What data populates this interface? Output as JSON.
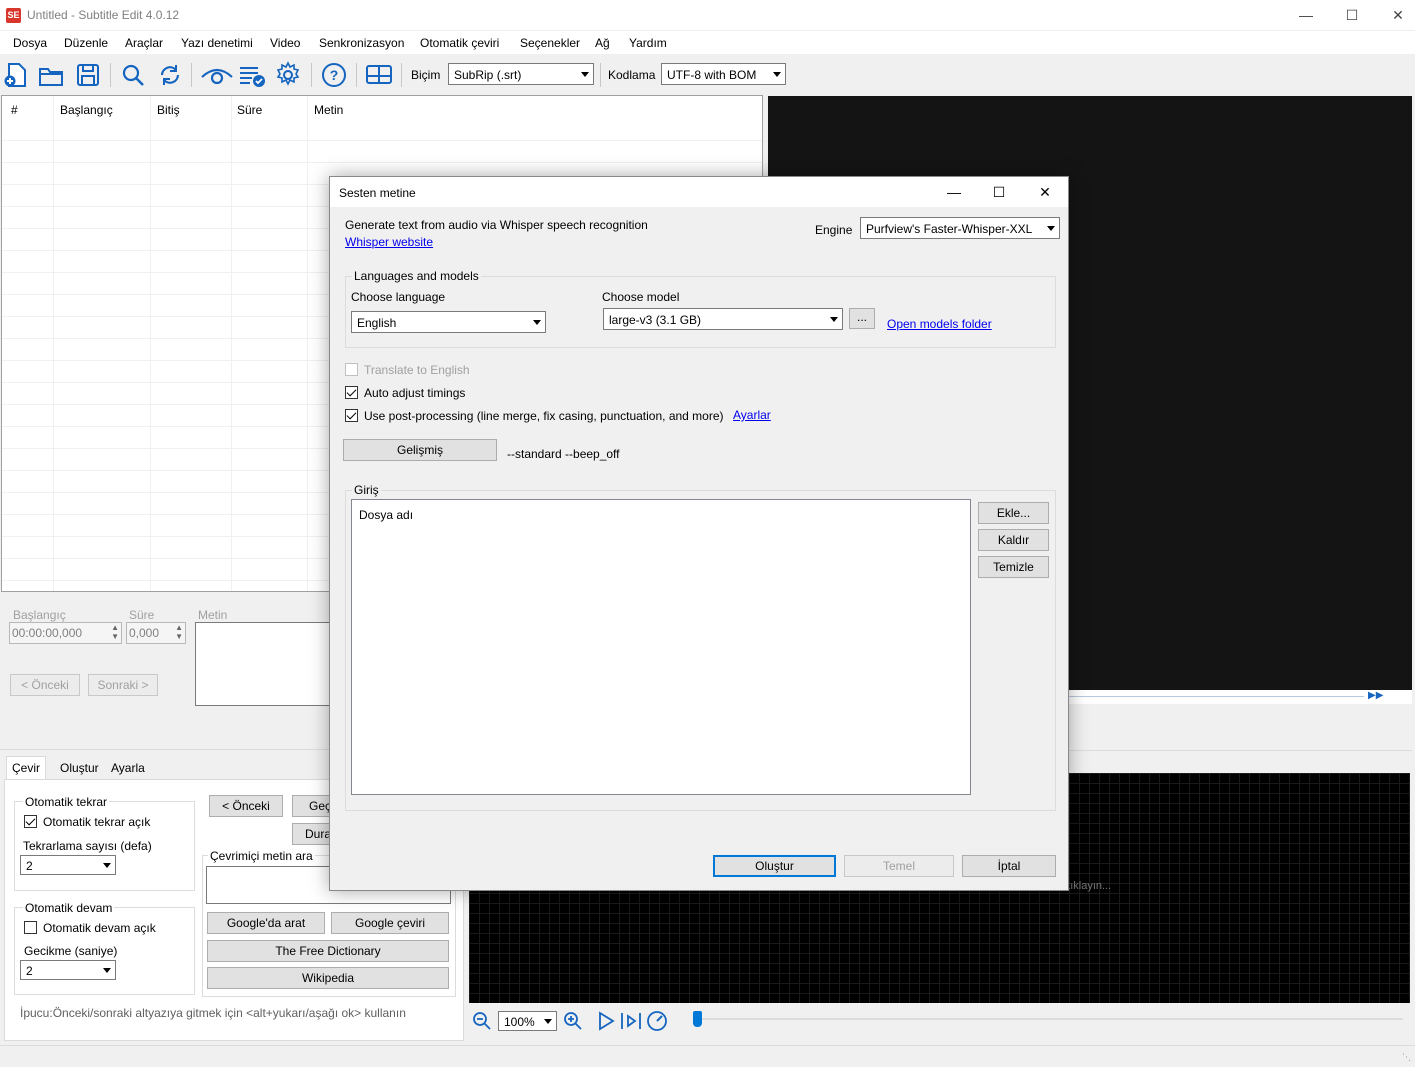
{
  "window": {
    "title": "Untitled - Subtitle Edit 4.0.12",
    "logo": "SE"
  },
  "menu": [
    "Dosya",
    "Düzenle",
    "Araçlar",
    "Yazı denetimi",
    "Video",
    "Senkronizasyon",
    "Otomatik çeviri",
    "Seçenekler",
    "Ağ",
    "Yardım"
  ],
  "toolbar": {
    "format_label": "Biçim",
    "format_value": "SubRip (.srt)",
    "encoding_label": "Kodlama",
    "encoding_value": "UTF-8 with BOM",
    "icons": [
      "new-file-icon",
      "open-folder-icon",
      "save-icon",
      "find-icon",
      "replace-icon",
      "visual-sync-icon",
      "spell-check-icon",
      "settings-icon",
      "help-icon",
      "layout-icon"
    ]
  },
  "subtitle_list": {
    "columns": [
      "#",
      "Başlangıç",
      "Bitiş",
      "Süre",
      "Metin"
    ]
  },
  "edit_panel": {
    "start_label": "Başlangıç",
    "start_value": "00:00:00,000",
    "duration_label": "Süre",
    "duration_value": "0,000",
    "text_label": "Metin",
    "prev_button": "< Önceki",
    "next_button": "Sonraki >"
  },
  "tabs": [
    "Çevir",
    "Oluştur",
    "Ayarla"
  ],
  "translate_panel": {
    "auto_repeat_title": "Otomatik tekrar",
    "auto_repeat_on": "Otomatik tekrar açık",
    "repeat_count_label": "Tekrarlama sayısı (defa)",
    "repeat_count_value": "2",
    "auto_continue_title": "Otomatik devam",
    "auto_continue_on": "Otomatik devam açık",
    "delay_label": "Gecikme (saniye)",
    "delay_value": "2",
    "prev_button": "< Önceki",
    "play_button": "Geç",
    "stop_button": "Dura",
    "online_search_label": "Çevrimiçi metin ara",
    "google_search": "Google'da arat",
    "google_translate": "Google çeviri",
    "free_dictionary": "The Free Dictionary",
    "wikipedia": "Wikipedia",
    "tip": "İpucu:Önceki/sonraki altyazıya gitmek için <alt+yukarı/aşağı ok> kullanın"
  },
  "waveform": {
    "zoom_value": "100%",
    "click_hint": "...tıklayın..."
  },
  "dialog": {
    "title": "Sesten metine",
    "intro": "Generate text from audio via Whisper speech recognition",
    "whisper_link": "Whisper website",
    "engine_label": "Engine",
    "engine_value": "Purfview's Faster-Whisper-XXL",
    "languages_models_title": "Languages and models",
    "choose_language_label": "Choose language",
    "language_value": "English",
    "choose_model_label": "Choose model",
    "model_value": "large-v3 (3.1 GB)",
    "browse_button": "...",
    "open_models_folder": "Open models folder",
    "translate_to_english": "Translate to English",
    "auto_adjust_timings": "Auto adjust timings",
    "post_processing": "Use post-processing (line merge, fix casing, punctuation, and more)",
    "settings_link": "Ayarlar",
    "advanced_button": "Gelişmiş",
    "advanced_args": "--standard --beep_off",
    "input_title": "Giriş",
    "input_column": "Dosya adı",
    "add_button": "Ekle...",
    "remove_button": "Kaldır",
    "clear_button": "Temizle",
    "generate_button": "Oluştur",
    "batch_button": "Temel",
    "cancel_button": "İptal"
  }
}
